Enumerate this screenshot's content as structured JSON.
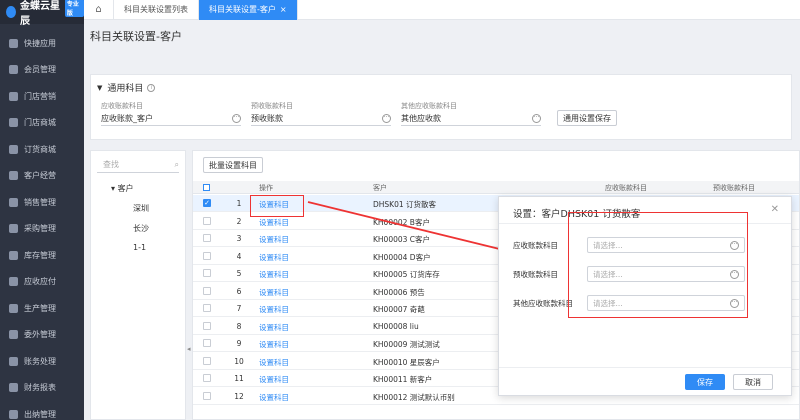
{
  "sidebar": {
    "logo_text": "金蝶云星辰",
    "logo_badge": "专业版",
    "items": [
      {
        "label": "快捷应用",
        "icon": "grid-icon"
      },
      {
        "label": "会员管理",
        "icon": "member-icon"
      },
      {
        "label": "门店营销",
        "icon": "store-marketing-icon"
      },
      {
        "label": "门店商城",
        "icon": "store-mall-icon"
      },
      {
        "label": "订货商城",
        "icon": "order-mall-icon"
      },
      {
        "label": "客户经营",
        "icon": "customer-icon"
      },
      {
        "label": "销售管理",
        "icon": "sales-icon"
      },
      {
        "label": "采购管理",
        "icon": "purchase-icon"
      },
      {
        "label": "库存管理",
        "icon": "inventory-icon"
      },
      {
        "label": "应收应付",
        "icon": "finance-icon"
      },
      {
        "label": "生产管理",
        "icon": "production-icon"
      },
      {
        "label": "委外管理",
        "icon": "outsourcing-icon"
      },
      {
        "label": "账务处理",
        "icon": "accounting-icon"
      },
      {
        "label": "财务报表",
        "icon": "report-icon"
      },
      {
        "label": "出纳管理",
        "icon": "cashier-icon"
      }
    ]
  },
  "tabs": [
    {
      "label": "科目关联设置列表"
    },
    {
      "label": "科目关联设置-客户",
      "close": "×"
    }
  ],
  "page_title": "科目关联设置-客户",
  "general": {
    "title": "通用科目",
    "fields": [
      {
        "label": "应收账款科目",
        "value": "应收账款_客户"
      },
      {
        "label": "预收账款科目",
        "value": "预收账款"
      },
      {
        "label": "其他应收账款科目",
        "value": "其他应收款"
      }
    ],
    "save_label": "通用设置保存"
  },
  "tree": {
    "search_placeholder": "查找",
    "root": "客户",
    "children": [
      "深圳",
      "长沙",
      "1-1"
    ]
  },
  "table": {
    "batch_label": "批量设置科目",
    "headers": {
      "op": "操作",
      "customer": "客户",
      "recv": "应收账款科目",
      "prepay": "预收账款科目"
    },
    "link_label": "设置科目",
    "rows": [
      {
        "idx": "1",
        "customer": "DHSK01  订货散客",
        "selected": true
      },
      {
        "idx": "2",
        "customer": "KH00002  B客户"
      },
      {
        "idx": "3",
        "customer": "KH00003  C客户"
      },
      {
        "idx": "4",
        "customer": "KH00004  D客户"
      },
      {
        "idx": "5",
        "customer": "KH00005  订货库存"
      },
      {
        "idx": "6",
        "customer": "KH00006  预告"
      },
      {
        "idx": "7",
        "customer": "KH00007  奇葩"
      },
      {
        "idx": "8",
        "customer": "KH00008  liu"
      },
      {
        "idx": "9",
        "customer": "KH00009  测试测试"
      },
      {
        "idx": "10",
        "customer": "KH00010  星辰客户"
      },
      {
        "idx": "11",
        "customer": "KH00011  新客户"
      },
      {
        "idx": "12",
        "customer": "KH00012  测试默认币别"
      }
    ]
  },
  "modal": {
    "title": "设置：客户DHSK01 订货散客",
    "fields": [
      {
        "label": "应收账款科目",
        "placeholder": "请选择..."
      },
      {
        "label": "预收账款科目",
        "placeholder": "请选择..."
      },
      {
        "label": "其他应收账款科目",
        "placeholder": "请选择..."
      }
    ],
    "save": "保存",
    "cancel": "取消"
  }
}
